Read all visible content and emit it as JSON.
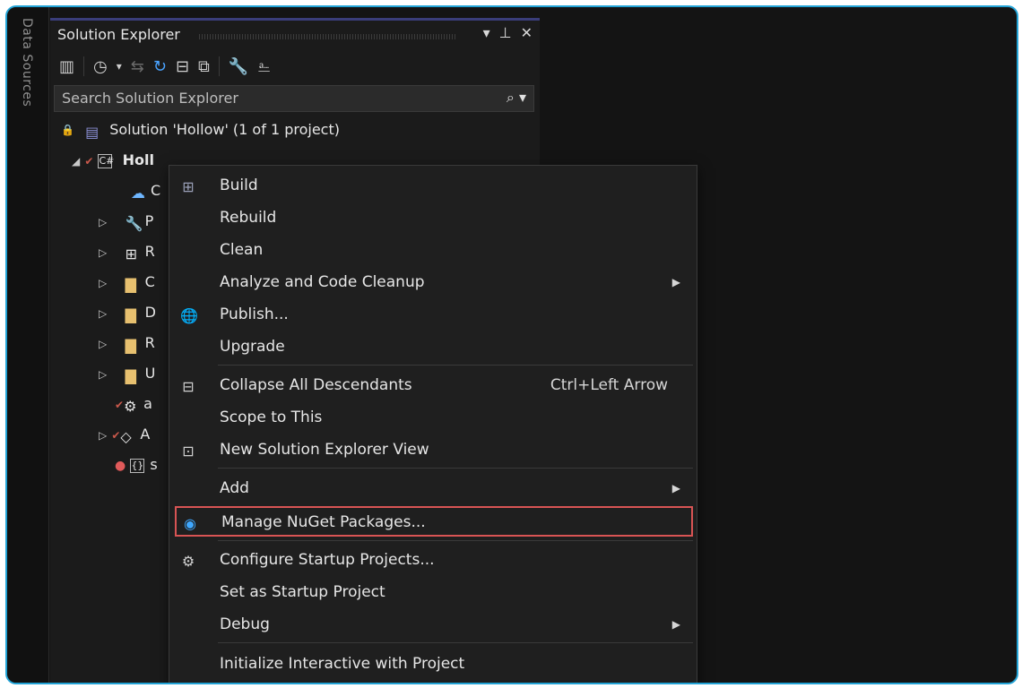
{
  "side_tab": {
    "label": "Data Sources"
  },
  "panel": {
    "title": "Solution Explorer",
    "title_buttons": [
      "▾",
      "⊥",
      "✕"
    ],
    "search_placeholder": "Search Solution Explorer"
  },
  "tree": {
    "solution_label": "Solution 'Hollow' (1 of 1 project)",
    "project_label": "Holl",
    "rows": [
      {
        "text": "C"
      },
      {
        "text": "P"
      },
      {
        "text": "R"
      },
      {
        "text": "C"
      },
      {
        "text": "D"
      },
      {
        "text": "R"
      },
      {
        "text": "U"
      },
      {
        "text": "a"
      },
      {
        "text": "A"
      },
      {
        "text": "s"
      }
    ]
  },
  "context_menu": {
    "items": [
      {
        "label": "Build"
      },
      {
        "label": "Rebuild"
      },
      {
        "label": "Clean"
      },
      {
        "label": "Analyze and Code Cleanup",
        "submenu": true
      },
      {
        "label": "Publish..."
      },
      {
        "label": "Upgrade"
      },
      {
        "label": "Collapse All Descendants",
        "shortcut": "Ctrl+Left Arrow"
      },
      {
        "label": "Scope to This"
      },
      {
        "label": "New Solution Explorer View"
      },
      {
        "label": "Add",
        "submenu": true
      },
      {
        "label": "Manage NuGet Packages...",
        "highlighted": true
      },
      {
        "label": "Configure Startup Projects..."
      },
      {
        "label": "Set as Startup Project"
      },
      {
        "label": "Debug",
        "submenu": true
      },
      {
        "label": "Initialize Interactive with Project"
      }
    ]
  },
  "colors": {
    "frame_border": "#22a3d6",
    "highlight_border": "#d85454"
  }
}
